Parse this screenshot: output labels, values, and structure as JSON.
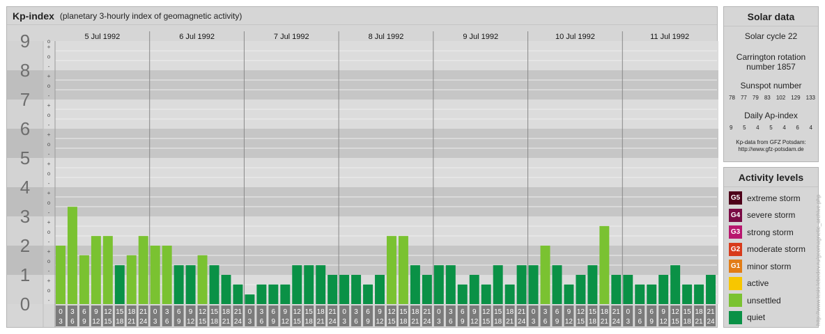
{
  "header": {
    "title": "Kp-index",
    "subtitle": "(planetary 3-hourly index of geomagnetic activity)"
  },
  "chart_data": {
    "type": "bar",
    "title": "Kp-index",
    "subtitle": "(planetary 3-hourly index of geomagnetic activity)",
    "ylim": [
      0,
      9
    ],
    "y_ticks": [
      "0",
      "1",
      "2",
      "3",
      "4",
      "5",
      "6",
      "7",
      "8",
      "9"
    ],
    "minor_tick_labels": [
      "+",
      "o",
      "-"
    ],
    "days": [
      "5 Jul 1992",
      "6 Jul 1992",
      "7 Jul 1992",
      "8 Jul 1992",
      "9 Jul 1992",
      "10 Jul 1992",
      "11 Jul 1992"
    ],
    "interval_labels": [
      [
        "0",
        "3"
      ],
      [
        "3",
        "6"
      ],
      [
        "6",
        "9"
      ],
      [
        "9",
        "12"
      ],
      [
        "12",
        "15"
      ],
      [
        "15",
        "18"
      ],
      [
        "18",
        "21"
      ],
      [
        "21",
        "24"
      ]
    ],
    "values": [
      2.0,
      3.33,
      1.67,
      2.33,
      2.33,
      1.33,
      1.67,
      2.33,
      2.0,
      2.0,
      1.33,
      1.33,
      1.67,
      1.33,
      1.0,
      0.67,
      0.33,
      0.67,
      0.67,
      0.67,
      1.33,
      1.33,
      1.33,
      1.0,
      1.0,
      1.0,
      0.67,
      1.0,
      2.33,
      2.33,
      1.33,
      1.0,
      1.33,
      1.33,
      0.67,
      1.0,
      0.67,
      1.33,
      0.67,
      1.33,
      1.33,
      2.0,
      1.33,
      0.67,
      1.0,
      1.33,
      2.67,
      1.0,
      1.0,
      0.67,
      0.67,
      1.0,
      1.33,
      0.67,
      0.67,
      1.0
    ],
    "activity_colors": {
      "quiet": "#0a9146",
      "unsettled": "#7ac231"
    }
  },
  "solar": {
    "title": "Solar data",
    "cycle": "Solar cycle 22",
    "carrington_line1": "Carrington rotation",
    "carrington_line2": "number 1857",
    "sunspot_label": "Sunspot number",
    "sunspot_values": [
      "78",
      "77",
      "79",
      "83",
      "102",
      "129",
      "133"
    ],
    "ap_label": "Daily Ap-index",
    "ap_values": [
      "9",
      "5",
      "4",
      "5",
      "4",
      "6",
      "4"
    ],
    "credit_line1": "Kp-data from GFZ Potsdam:",
    "credit_line2": "http://www.gfz-potsdam.de"
  },
  "levels": {
    "title": "Activity levels",
    "items": [
      {
        "code": "G5",
        "label": "extreme storm",
        "color": "#4d0019"
      },
      {
        "code": "G4",
        "label": "severe storm",
        "color": "#7a0b45"
      },
      {
        "code": "G3",
        "label": "strong storm",
        "color": "#b8166e"
      },
      {
        "code": "G2",
        "label": "moderate storm",
        "color": "#d83b1b"
      },
      {
        "code": "G1",
        "label": "minor storm",
        "color": "#e27d16"
      },
      {
        "code": "",
        "label": "active",
        "color": "#f7c600"
      },
      {
        "code": "",
        "label": "unsettled",
        "color": "#7ac231"
      },
      {
        "code": "",
        "label": "quiet",
        "color": "#0a9146"
      }
    ]
  },
  "watermark": "http://www.tesis.lebedev.ru/geomagnetic_archive.php"
}
